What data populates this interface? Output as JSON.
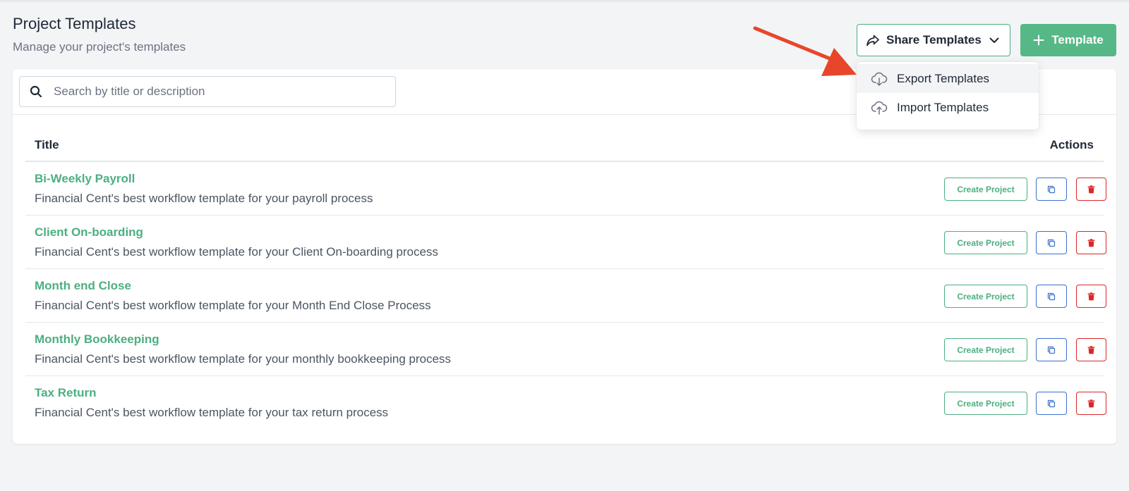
{
  "header": {
    "title": "Project Templates",
    "subtitle": "Manage your project's templates"
  },
  "toolbar": {
    "share_label": "Share Templates",
    "share_icon": "share-arrow-icon",
    "template_label": "Template",
    "template_icon": "plus-icon"
  },
  "share_menu": {
    "items": [
      {
        "label": "Export Templates",
        "icon": "cloud-download-icon",
        "highlighted": true
      },
      {
        "label": "Import Templates",
        "icon": "cloud-upload-icon",
        "highlighted": false
      }
    ]
  },
  "search": {
    "placeholder": "Search by title or description",
    "value": ""
  },
  "table": {
    "columns": {
      "title": "Title",
      "actions": "Actions"
    },
    "rows": [
      {
        "title": "Bi-Weekly Payroll",
        "description": "Financial Cent's best workflow template for your payroll process",
        "create_label": "Create Project"
      },
      {
        "title": "Client On-boarding",
        "description": "Financial Cent's best workflow template for your Client On-boarding process",
        "create_label": "Create Project"
      },
      {
        "title": "Month end Close",
        "description": "Financial Cent's best workflow template for your Month End Close Process",
        "create_label": "Create Project"
      },
      {
        "title": "Monthly Bookkeeping",
        "description": "Financial Cent's best workflow template for your monthly bookkeeping process",
        "create_label": "Create Project"
      },
      {
        "title": "Tax Return",
        "description": "Financial Cent's best workflow template for your tax return process",
        "create_label": "Create Project"
      }
    ]
  },
  "colors": {
    "brand_green": "#56b887",
    "copy_blue": "#3b6fd1",
    "delete_red": "#dc2626",
    "annotation_arrow": "#e8462a"
  }
}
